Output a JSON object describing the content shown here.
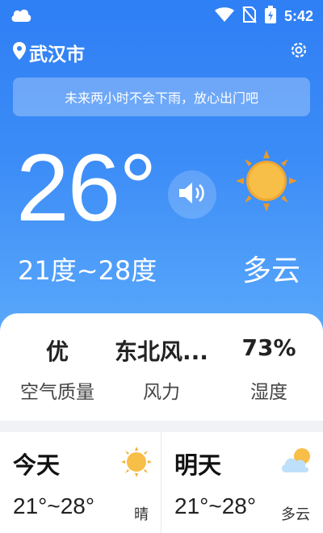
{
  "status_bar": {
    "time": "5:42",
    "icons": [
      "cloud-icon",
      "wifi-icon",
      "no-sim-icon",
      "battery-charging-icon"
    ]
  },
  "header": {
    "city": "武汉市",
    "location_icon": "location-pin-icon",
    "settings_icon": "gear-icon"
  },
  "notice": "未来两小时不会下雨，放心出门吧",
  "current": {
    "temperature": "26°",
    "range": "21度~28度",
    "condition": "多云",
    "speaker_icon": "speaker-icon",
    "condition_icon": "sun-icon"
  },
  "metrics": [
    {
      "value": "优",
      "label": "空气质量"
    },
    {
      "value": "东北风...",
      "label": "风力"
    },
    {
      "value": "73%",
      "label": "湿度"
    }
  ],
  "forecast": [
    {
      "day": "今天",
      "range": "21°~28°",
      "condition": "晴",
      "icon": "sun-icon"
    },
    {
      "day": "明天",
      "range": "21°~28°",
      "condition": "多云",
      "icon": "partly-cloudy-icon"
    }
  ],
  "colors": {
    "hero_top": "#2f7ff5",
    "hero_bottom": "#5aa9fb",
    "sun": "#f5b63a"
  }
}
